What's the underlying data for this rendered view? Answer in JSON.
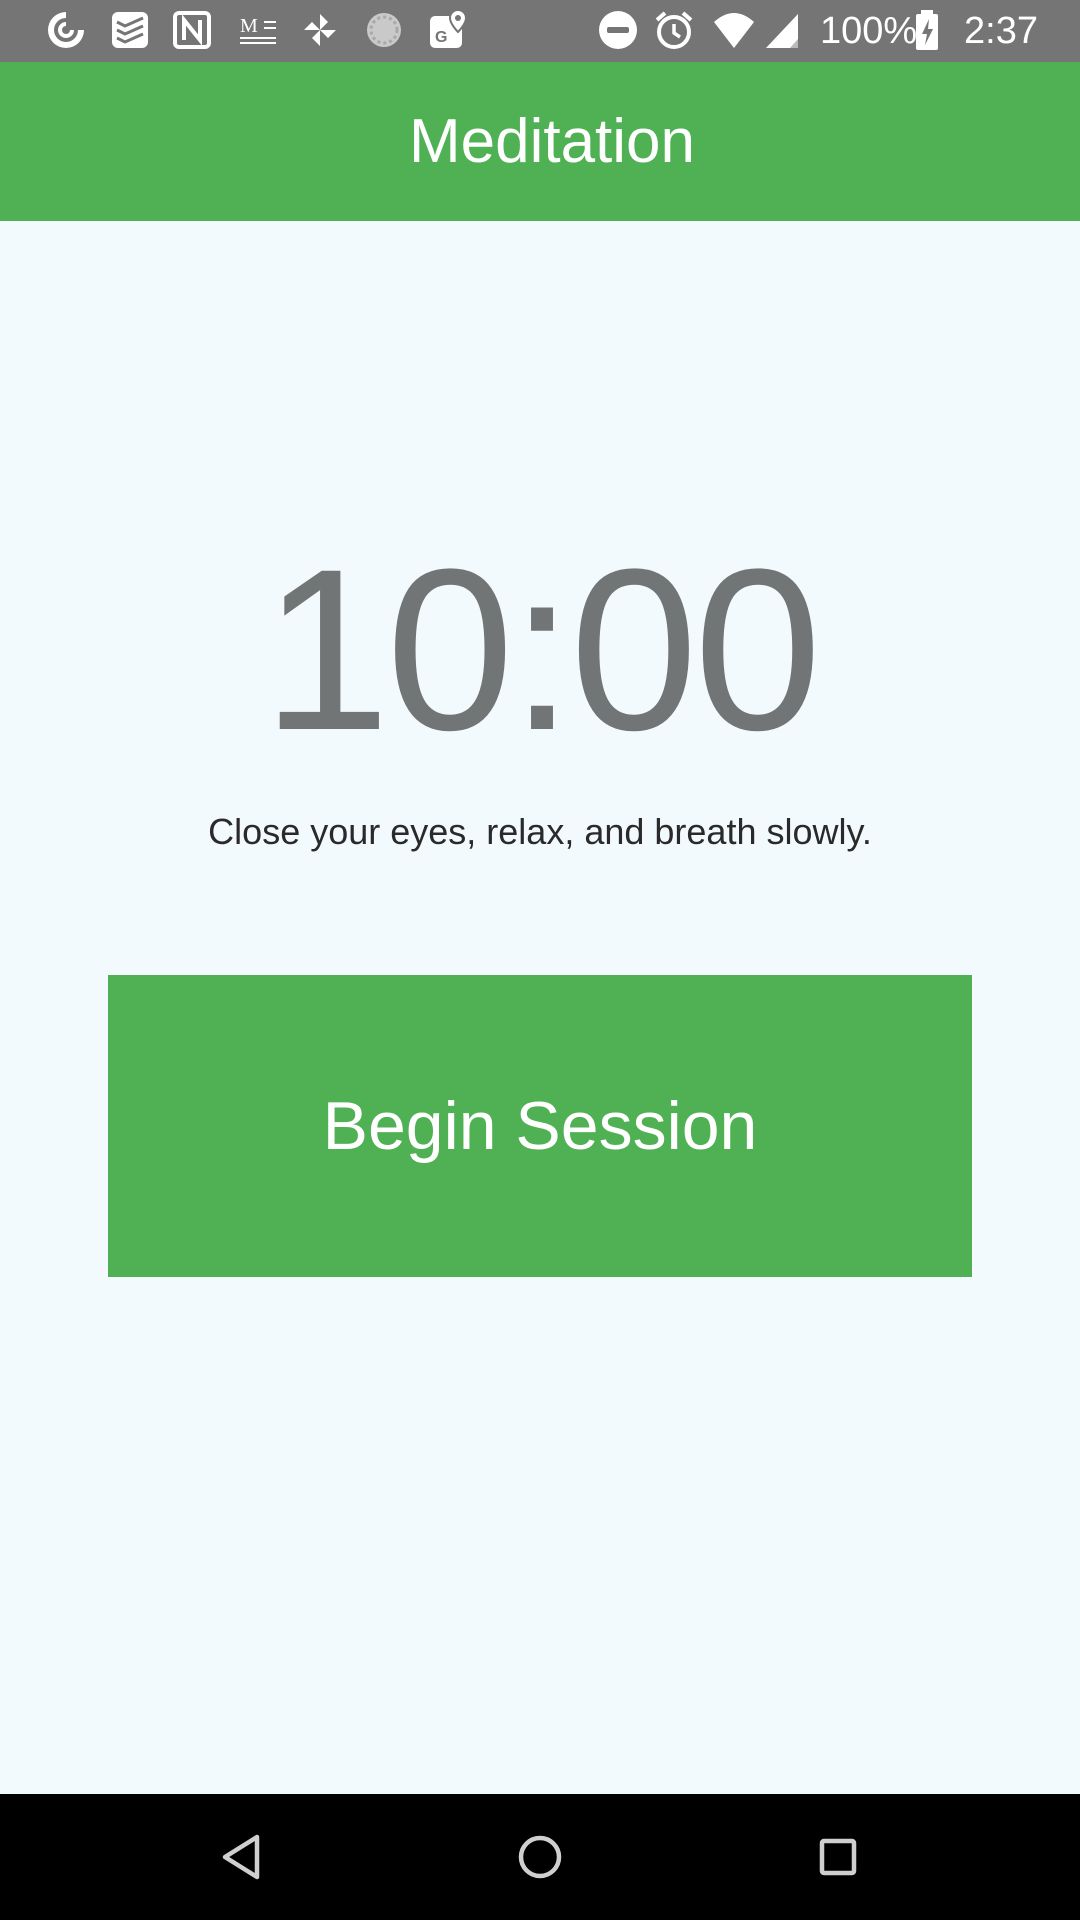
{
  "status_bar": {
    "battery_text": "100%",
    "time": "2:37",
    "left_icons": [
      "pocket-casts-icon",
      "todoist-icon",
      "notion-icon",
      "markdown-icon",
      "pinwheel-icon",
      "loading-circle-icon",
      "google-maps-icon"
    ],
    "right_icons": [
      "do-not-disturb-icon",
      "alarm-icon",
      "wifi-icon",
      "cellular-signal-icon",
      "battery-charging-icon"
    ]
  },
  "app_bar": {
    "title": "Meditation"
  },
  "main": {
    "timer": "10:00",
    "instruction": "Close your eyes, relax, and breath slowly.",
    "begin_button_label": "Begin Session"
  },
  "nav_bar": {
    "buttons": [
      "back-icon",
      "home-icon",
      "recents-icon"
    ]
  },
  "colors": {
    "status_bar": "#757575",
    "accent": "#4fb153",
    "background": "#f3fafd",
    "timer_text": "#727576",
    "nav_bar": "#000000"
  }
}
